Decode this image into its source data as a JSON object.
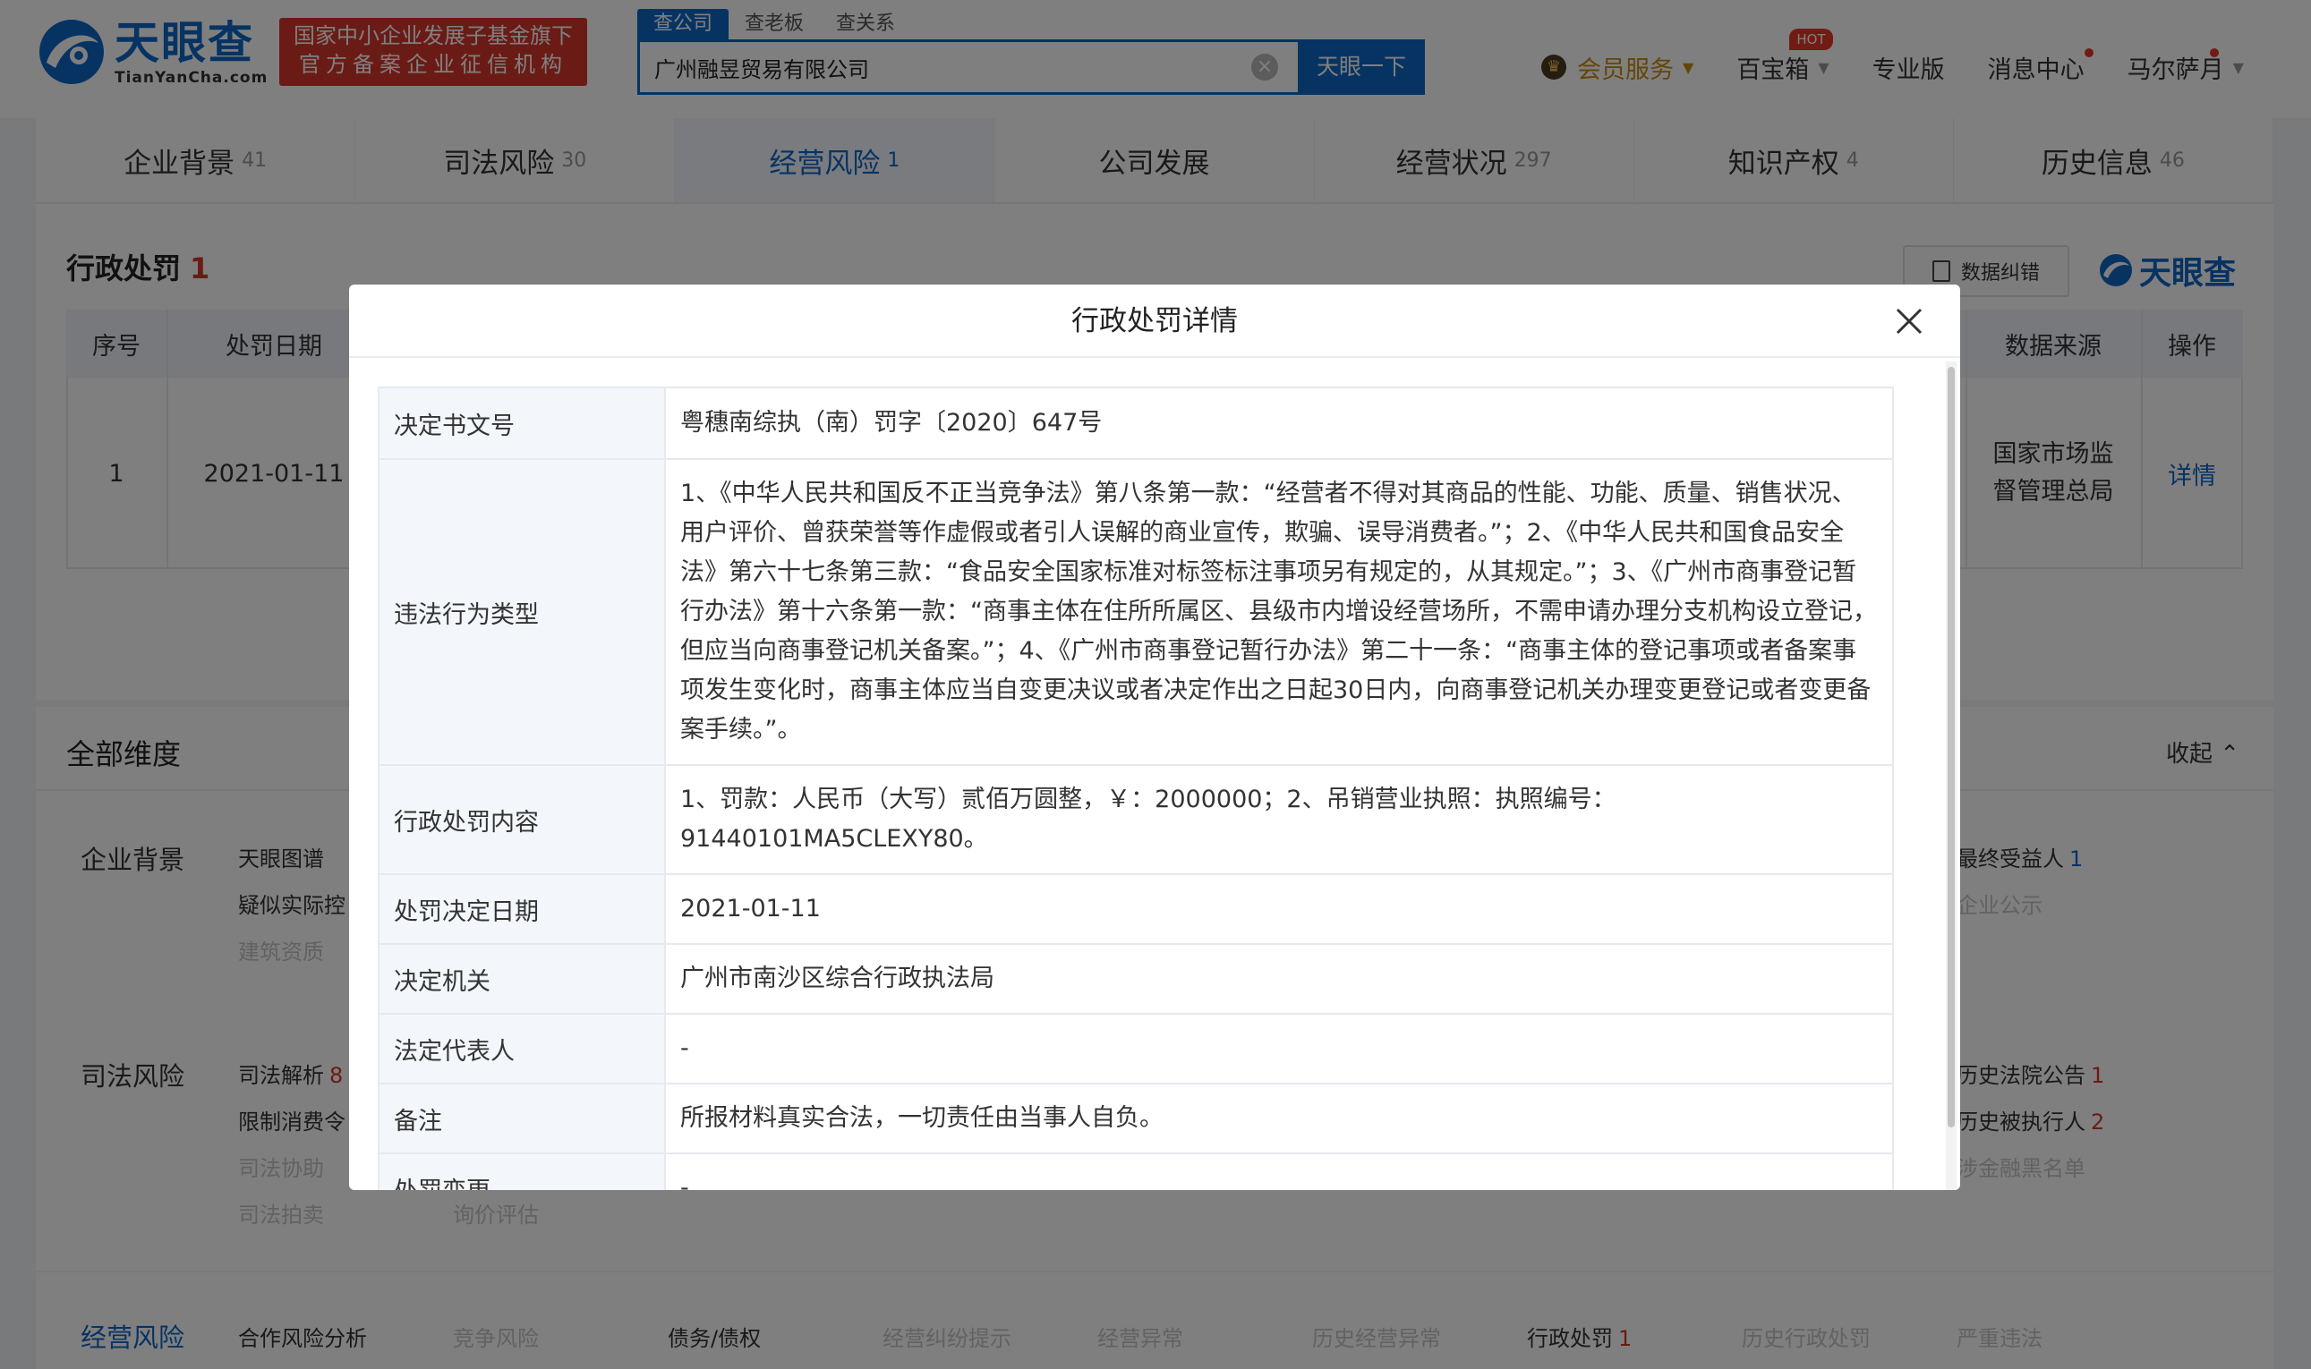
{
  "brand": {
    "logo_cn": "天眼查",
    "logo_en": "TianYanCha.com",
    "gov_badge_line1": "国家中小企业发展子基金旗下",
    "gov_badge_line2": "官方备案企业征信机构"
  },
  "search": {
    "tabs": [
      {
        "label": "查公司",
        "active": true
      },
      {
        "label": "查老板",
        "active": false
      },
      {
        "label": "查关系",
        "active": false
      }
    ],
    "value": "广州融昱贸易有限公司",
    "clear_glyph": "×",
    "button_label": "天眼一下"
  },
  "nav": {
    "vip_label": "会员服务",
    "toolbox_label": "百宝箱",
    "toolbox_badge": "HOT",
    "pro_label": "专业版",
    "messages_label": "消息中心",
    "user_label": "马尔萨月"
  },
  "main_tabs": [
    {
      "label": "企业背景",
      "count": "41",
      "active": false
    },
    {
      "label": "司法风险",
      "count": "30",
      "active": false
    },
    {
      "label": "经营风险",
      "count": "1",
      "active": true
    },
    {
      "label": "公司发展",
      "count": "",
      "active": false
    },
    {
      "label": "经营状况",
      "count": "297",
      "active": false
    },
    {
      "label": "知识产权",
      "count": "4",
      "active": false
    },
    {
      "label": "历史信息",
      "count": "46",
      "active": false
    }
  ],
  "section": {
    "title": "行政处罚",
    "count": "1",
    "report_label": "数据纠错",
    "brand_small": "天眼查"
  },
  "penalty_table": {
    "headers": {
      "index": "序号",
      "date": "处罚日期",
      "source": "数据来源",
      "action": "操作"
    },
    "rows": [
      {
        "index": "1",
        "date": "2021-01-11",
        "source_line1": "国家市场监",
        "source_line2": "督管理总局",
        "action": "详情"
      }
    ]
  },
  "dimensions": {
    "title": "全部维度",
    "collapse_label": "收起",
    "groups": {
      "background": {
        "label": "企业背景",
        "left_items": [
          "天眼图谱",
          "疑似实际控",
          "建筑资质"
        ],
        "right_items": [
          {
            "label": "最终受益人",
            "count": "1"
          },
          {
            "label": "企业公示",
            "count": ""
          }
        ]
      },
      "judicial": {
        "label": "司法风险",
        "left_items": [
          {
            "label": "司法解析",
            "count": "8"
          },
          {
            "label": "限制消费令",
            "count": ""
          },
          {
            "label": "司法协助",
            "count": ""
          },
          {
            "label": "司法拍卖",
            "count": ""
          }
        ],
        "extra_item": "询价评估",
        "right_items": [
          {
            "label": "历史法院公告",
            "count": "1"
          },
          {
            "label": "历史被执行人",
            "count": "2"
          },
          {
            "label": "涉金融黑名单",
            "count": ""
          }
        ]
      }
    },
    "bottom": {
      "label": "经营风险",
      "items": [
        {
          "label": "合作风险分析",
          "count": ""
        },
        {
          "label": "竞争风险",
          "count": ""
        },
        {
          "label": "债务/债权",
          "count": ""
        },
        {
          "label": "经营纠纷提示",
          "count": ""
        },
        {
          "label": "经营异常",
          "count": ""
        },
        {
          "label": "历史经营异常",
          "count": ""
        },
        {
          "label": "行政处罚",
          "count": "1"
        },
        {
          "label": "历史行政处罚",
          "count": ""
        },
        {
          "label": "严重违法",
          "count": ""
        }
      ]
    }
  },
  "modal": {
    "title": "行政处罚详情",
    "fields": [
      {
        "key": "决定书文号",
        "value": "粤穗南综执（南）罚字〔2020〕647号"
      },
      {
        "key": "违法行为类型",
        "value": "1、《中华人民共和国反不正当竞争法》第八条第一款：“经营者不得对其商品的性能、功能、质量、销售状况、用户评价、曾获荣誉等作虚假或者引人误解的商业宣传，欺骗、误导消费者。”；2、《中华人民共和国食品安全法》第六十七条第三款：“食品安全国家标准对标签标注事项另有规定的，从其规定。”；3、《广州市商事登记暂行办法》第十六条第一款：“商事主体在住所所属区、县级市内增设经营场所，不需申请办理分支机构设立登记，但应当向商事登记机关备案。”；4、《广州市商事登记暂行办法》第二十一条：“商事主体的登记事项或者备案事项发生变化时，商事主体应当自变更决议或者决定作出之日起30日内，向商事登记机关办理变更登记或者变更备案手续。”。"
      },
      {
        "key": "行政处罚内容",
        "value": "1、罚款：人民币（大写）贰佰万圆整，￥：2000000；2、吊销营业执照：执照编号：91440101MA5CLEXY80。"
      },
      {
        "key": "处罚决定日期",
        "value": "2021-01-11"
      },
      {
        "key": "决定机关",
        "value": "广州市南沙区综合行政执法局"
      },
      {
        "key": "法定代表人",
        "value": "-"
      },
      {
        "key": "备注",
        "value": "所报材料真实合法，一切责任由当事人自负。"
      },
      {
        "key": "处罚变更",
        "value": "-"
      }
    ]
  },
  "colors": {
    "brand_blue": "#0e67c7",
    "badge_red": "#d7362a",
    "vip_gold": "#c98a14"
  }
}
